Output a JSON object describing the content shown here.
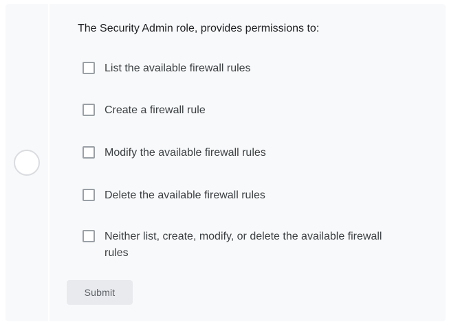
{
  "quiz": {
    "question": "The Security Admin role, provides permissions to:",
    "options": [
      {
        "label": "List the available firewall rules",
        "checked": false
      },
      {
        "label": "Create a firewall rule",
        "checked": false
      },
      {
        "label": "Modify the available firewall rules",
        "checked": false
      },
      {
        "label": "Delete the available firewall rules",
        "checked": false
      },
      {
        "label": "Neither list, create, modify, or delete the available firewall rules",
        "checked": false
      }
    ],
    "submit_label": "Submit"
  },
  "colors": {
    "card_background": "#f8f9fa",
    "checkbox_border": "#9aa0a6",
    "button_background": "#e8eaed",
    "button_text": "#5f6368",
    "status_circle_border": "#dadce0"
  }
}
